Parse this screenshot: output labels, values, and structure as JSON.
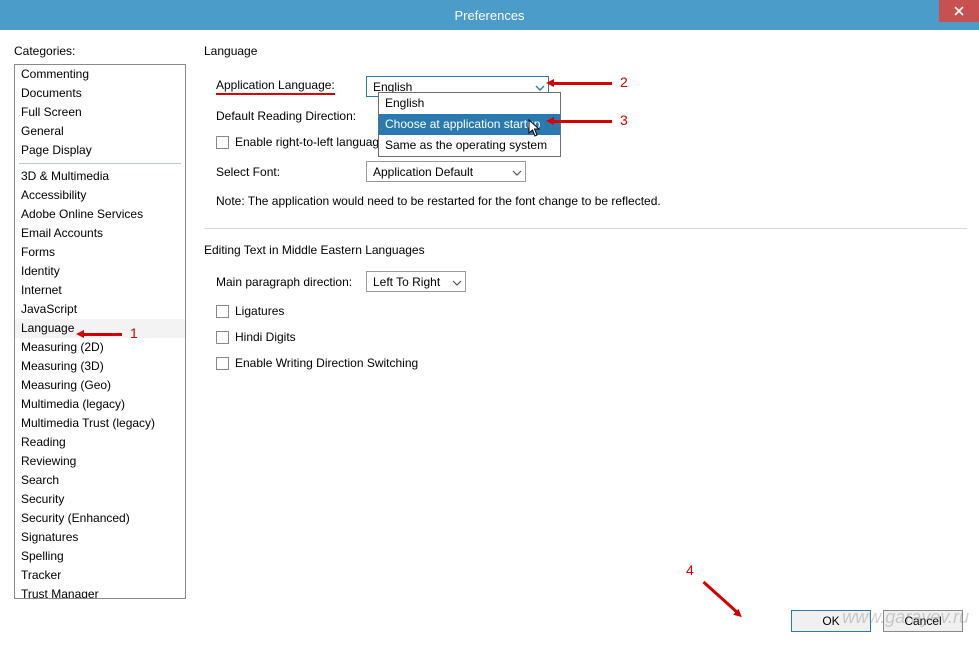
{
  "window": {
    "title": "Preferences"
  },
  "sidebar": {
    "label": "Categories:",
    "groups": [
      [
        "Commenting",
        "Documents",
        "Full Screen",
        "General",
        "Page Display"
      ],
      [
        "3D & Multimedia",
        "Accessibility",
        "Adobe Online Services",
        "Email Accounts",
        "Forms",
        "Identity",
        "Internet",
        "JavaScript",
        "Language",
        "Measuring (2D)",
        "Measuring (3D)",
        "Measuring (Geo)",
        "Multimedia (legacy)",
        "Multimedia Trust (legacy)",
        "Reading",
        "Reviewing",
        "Search",
        "Security",
        "Security (Enhanced)",
        "Signatures",
        "Spelling",
        "Tracker",
        "Trust Manager"
      ]
    ],
    "selected": "Language"
  },
  "lang_section": {
    "title": "Language",
    "app_lang_label": "Application Language:",
    "app_lang_value": "English",
    "app_lang_options": [
      "English",
      "Choose at application startup",
      "Same as the operating system"
    ],
    "app_lang_highlight": 1,
    "reading_dir_label": "Default Reading Direction:",
    "rtl_checkbox": "Enable right-to-left language options",
    "font_label": "Select Font:",
    "font_value": "Application Default",
    "note": "Note: The application would need to be restarted for the font change to be reflected."
  },
  "me_section": {
    "title": "Editing Text in Middle Eastern Languages",
    "para_dir_label": "Main paragraph direction:",
    "para_dir_value": "Left To Right",
    "ligatures": "Ligatures",
    "hindi_digits": "Hindi Digits",
    "writing_dir_switch": "Enable Writing Direction Switching"
  },
  "buttons": {
    "ok": "OK",
    "cancel": "Cancel"
  },
  "annotations": {
    "a1": "1",
    "a2": "2",
    "a3": "3",
    "a4": "4"
  },
  "watermark": "www.garayev.ru"
}
